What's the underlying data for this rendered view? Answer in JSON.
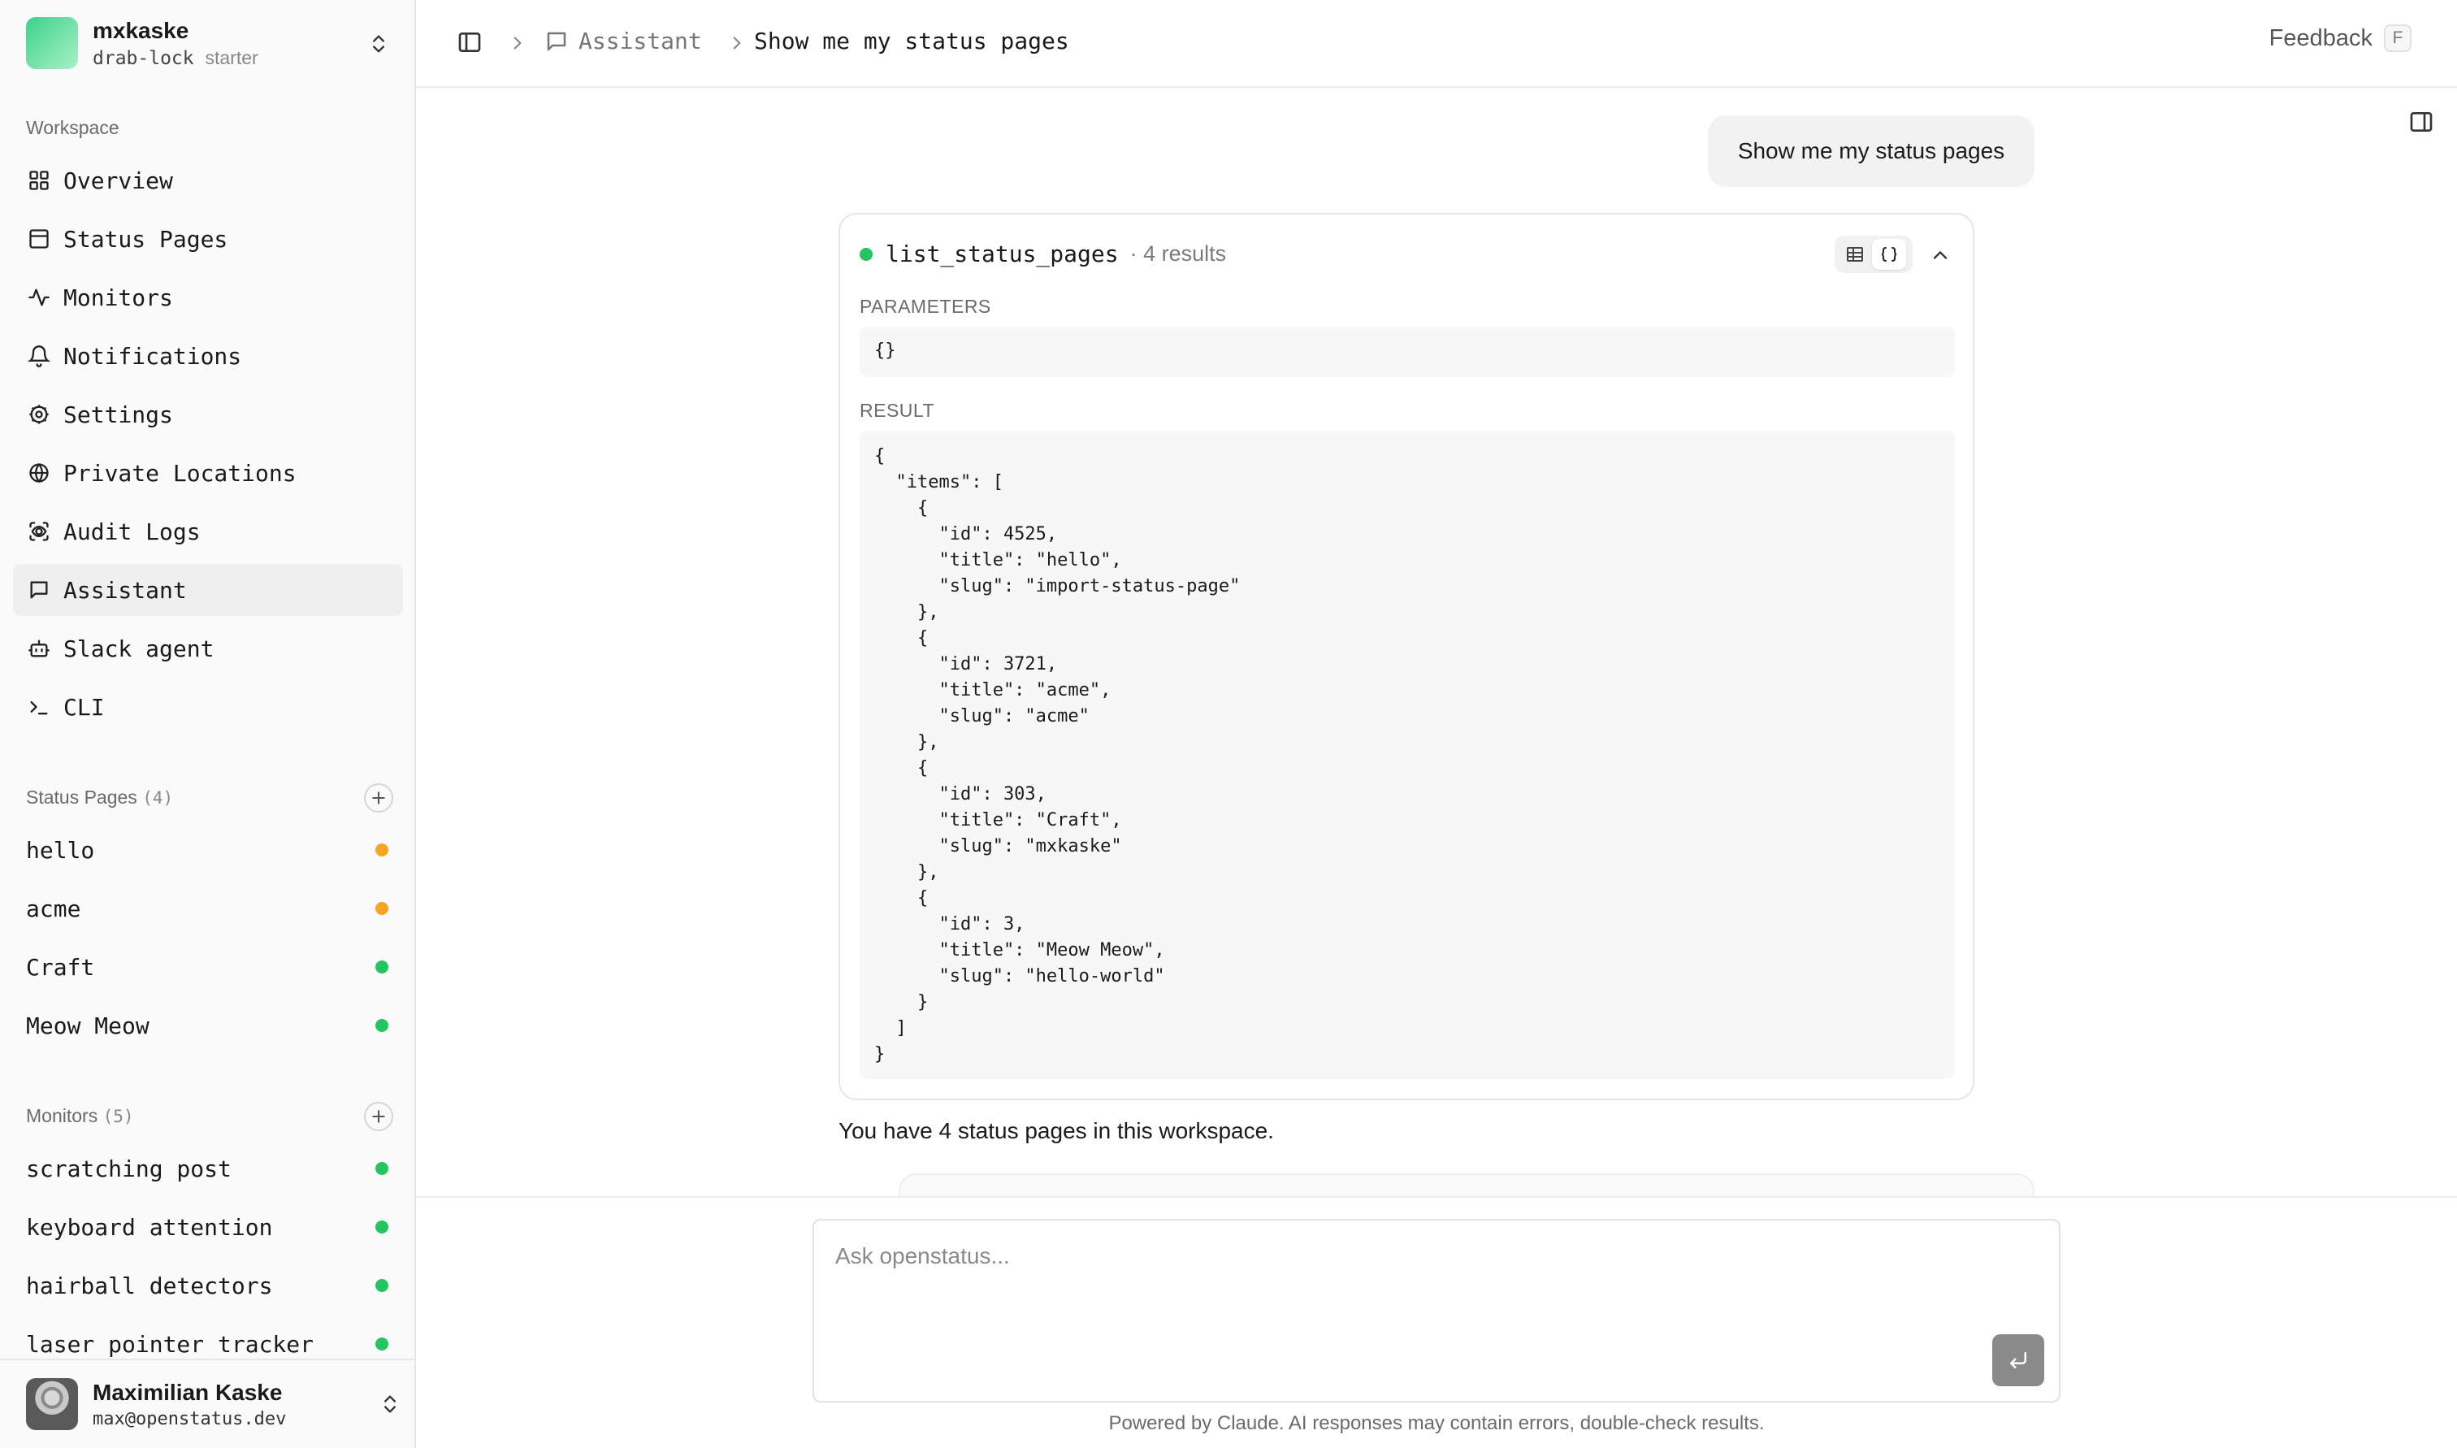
{
  "workspace": {
    "name": "mxkaske",
    "slug": "drab-lock",
    "plan": "starter"
  },
  "sidebar": {
    "section_label": "Workspace",
    "nav": [
      {
        "label": "Overview",
        "icon": "grid-icon"
      },
      {
        "label": "Status Pages",
        "icon": "panel-icon"
      },
      {
        "label": "Monitors",
        "icon": "activity-icon"
      },
      {
        "label": "Notifications",
        "icon": "bell-icon"
      },
      {
        "label": "Settings",
        "icon": "cog-icon"
      },
      {
        "label": "Private Locations",
        "icon": "globe-icon"
      },
      {
        "label": "Audit Logs",
        "icon": "scan-eye-icon"
      },
      {
        "label": "Assistant",
        "icon": "message-icon"
      },
      {
        "label": "Slack agent",
        "icon": "bot-icon"
      },
      {
        "label": "CLI",
        "icon": "terminal-icon"
      }
    ],
    "active": "Assistant",
    "status_pages": {
      "label": "Status Pages",
      "count": "(4)",
      "items": [
        {
          "label": "hello",
          "status": "degraded"
        },
        {
          "label": "acme",
          "status": "degraded"
        },
        {
          "label": "Craft",
          "status": "operational"
        },
        {
          "label": "Meow Meow",
          "status": "operational"
        }
      ]
    },
    "monitors": {
      "label": "Monitors",
      "count": "(5)",
      "items": [
        {
          "label": "scratching post",
          "status": "operational"
        },
        {
          "label": "keyboard attention",
          "status": "operational"
        },
        {
          "label": "hairball detectors",
          "status": "operational"
        },
        {
          "label": "laser pointer tracker",
          "status": "operational"
        }
      ]
    },
    "user": {
      "name": "Maximilian Kaske",
      "email": "max@openstatus.dev"
    }
  },
  "header": {
    "breadcrumb": [
      "Assistant",
      "Show me my status pages"
    ],
    "feedback_label": "Feedback",
    "feedback_shortcut": "F"
  },
  "chat": {
    "user_message": "Show me my status pages",
    "tool_call": {
      "name": "list_status_pages",
      "result_count": "· 4 results",
      "parameters_label": "PARAMETERS",
      "parameters": "{}",
      "result_label": "RESULT",
      "result": "{\n  \"items\": [\n    {\n      \"id\": 4525,\n      \"title\": \"hello\",\n      \"slug\": \"import-status-page\"\n    },\n    {\n      \"id\": 3721,\n      \"title\": \"acme\",\n      \"slug\": \"acme\"\n    },\n    {\n      \"id\": 303,\n      \"title\": \"Craft\",\n      \"slug\": \"mxkaske\"\n    },\n    {\n      \"id\": 3,\n      \"title\": \"Meow Meow\",\n      \"slug\": \"hello-world\"\n    }\n  ]\n}"
    },
    "assistant_message": "You have 4 status pages in this workspace."
  },
  "composer": {
    "placeholder": "Ask openstatus...",
    "value": "",
    "disclaimer": "Powered by Claude. AI responses may contain errors, double-check results."
  },
  "colors": {
    "operational": "#22c55e",
    "degraded": "#f5a524",
    "send_button": "#8a8a8a"
  }
}
